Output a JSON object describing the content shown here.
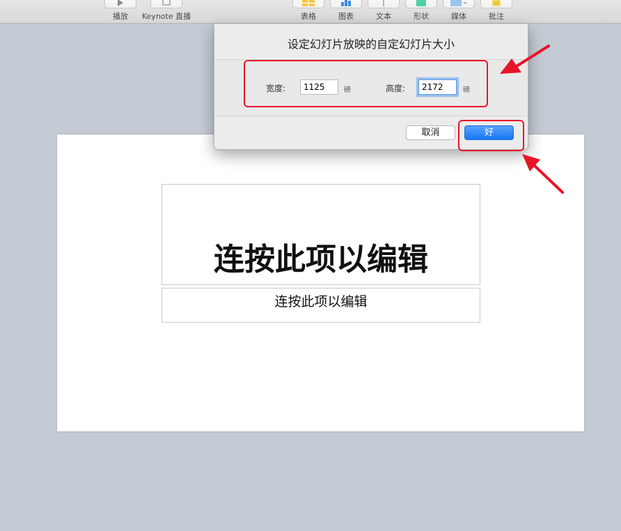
{
  "toolbar": {
    "items": [
      {
        "label": "播放",
        "icon": "play-icon"
      },
      {
        "label": "Keynote 直播",
        "icon": "keynote-live-icon"
      },
      {
        "label": "表格",
        "icon": "table-icon"
      },
      {
        "label": "图表",
        "icon": "chart-icon"
      },
      {
        "label": "文本",
        "icon": "text-icon"
      },
      {
        "label": "形状",
        "icon": "shape-icon"
      },
      {
        "label": "媒体",
        "icon": "media-icon"
      },
      {
        "label": "批注",
        "icon": "comment-icon"
      }
    ]
  },
  "dialog": {
    "title": "设定幻灯片放映的自定幻灯片大小",
    "width_label": "宽度:",
    "width_value": "1125",
    "width_unit": "磅",
    "height_label": "高度:",
    "height_value": "2172",
    "height_unit": "磅",
    "cancel_label": "取消",
    "ok_label": "好"
  },
  "slide": {
    "title_placeholder": "连按此项以编辑",
    "subtitle_placeholder": "连按此项以编辑"
  },
  "colors": {
    "annotation": "#e8142a",
    "accent_button": "#1676f3",
    "canvas_background": "#c5cbd4"
  }
}
